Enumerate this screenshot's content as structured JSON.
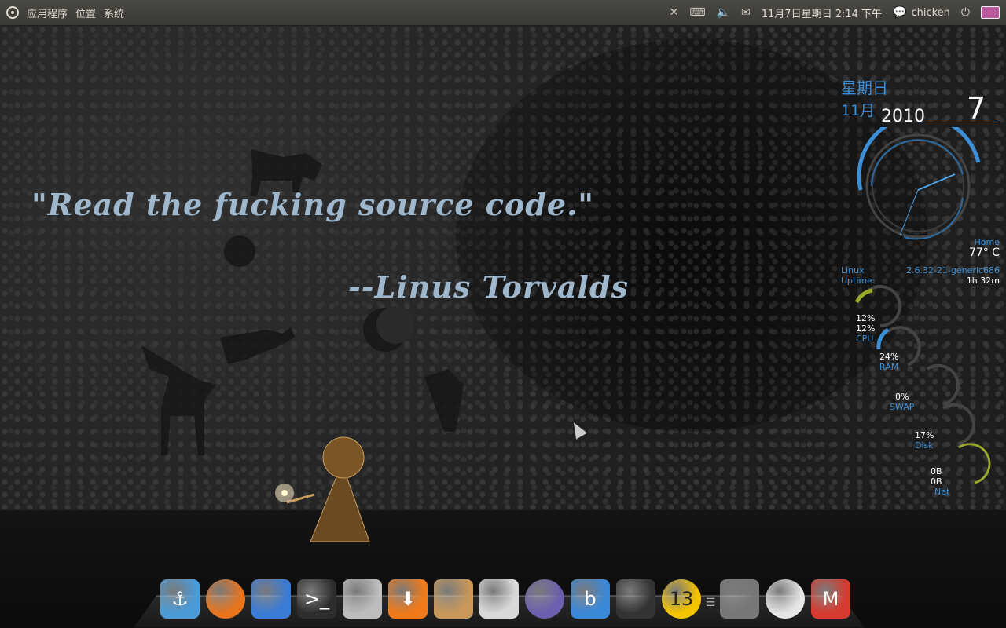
{
  "panel": {
    "menus": [
      "应用程序",
      "位置",
      "系统"
    ],
    "datetime": "11月7日星期日  2:14 下午",
    "user": "chicken"
  },
  "wallpaper": {
    "quote": "\"Read the fucking source code.\"",
    "author": "--Linus Torvalds"
  },
  "conky": {
    "weekday": "星期日",
    "month": "11月",
    "year": "2010",
    "day": "7",
    "weather_location": "Home",
    "temperature": "77° C",
    "os_label": "Linux",
    "kernel": "2.6.32-21-generic686",
    "uptime_label": "Uptime:",
    "uptime": "1h 32m",
    "cpu1": "12%",
    "cpu2": "12%",
    "cpu_label": "CPU",
    "ram": "24%",
    "ram_label": "RAM",
    "swap": "0%",
    "swap_label": "SWAP",
    "disk": "17%",
    "disk_label": "Disk",
    "net_up": "0B",
    "net_down": "0B",
    "net_label": "Net",
    "accent": "#3c8fd6",
    "gauge_green": "#9aa82a"
  },
  "dock": {
    "items": [
      {
        "name": "anchor-icon",
        "glyph": "⚓",
        "color": "#4a9bd8"
      },
      {
        "name": "firefox-icon",
        "glyph": "",
        "color": "#e8741c"
      },
      {
        "name": "windows-app-icon",
        "glyph": "",
        "color": "#3a7bd5"
      },
      {
        "name": "terminal-icon",
        "glyph": ">_",
        "color": "#2d2d2d"
      },
      {
        "name": "calculator-icon",
        "glyph": "",
        "color": "#bdbdbd"
      },
      {
        "name": "download-icon",
        "glyph": "⬇",
        "color": "#f07a1a"
      },
      {
        "name": "software-center-icon",
        "glyph": "",
        "color": "#c9985a"
      },
      {
        "name": "camera-icon",
        "glyph": "",
        "color": "#d9d9d9"
      },
      {
        "name": "aperture-icon",
        "glyph": "",
        "color": "#6b5fb0"
      },
      {
        "name": "b-app-icon",
        "glyph": "b",
        "color": "#3a88d8"
      },
      {
        "name": "clapperboard-icon",
        "glyph": "",
        "color": "#333333"
      },
      {
        "name": "billiard-ball-icon",
        "glyph": "13",
        "color": "#f5c400"
      },
      {
        "name": "trash-icon",
        "glyph": "",
        "color": "#777777"
      },
      {
        "name": "clock-icon",
        "glyph": "",
        "color": "#e6e6e6"
      },
      {
        "name": "gmail-icon",
        "glyph": "M",
        "color": "#d63b2f"
      }
    ]
  }
}
